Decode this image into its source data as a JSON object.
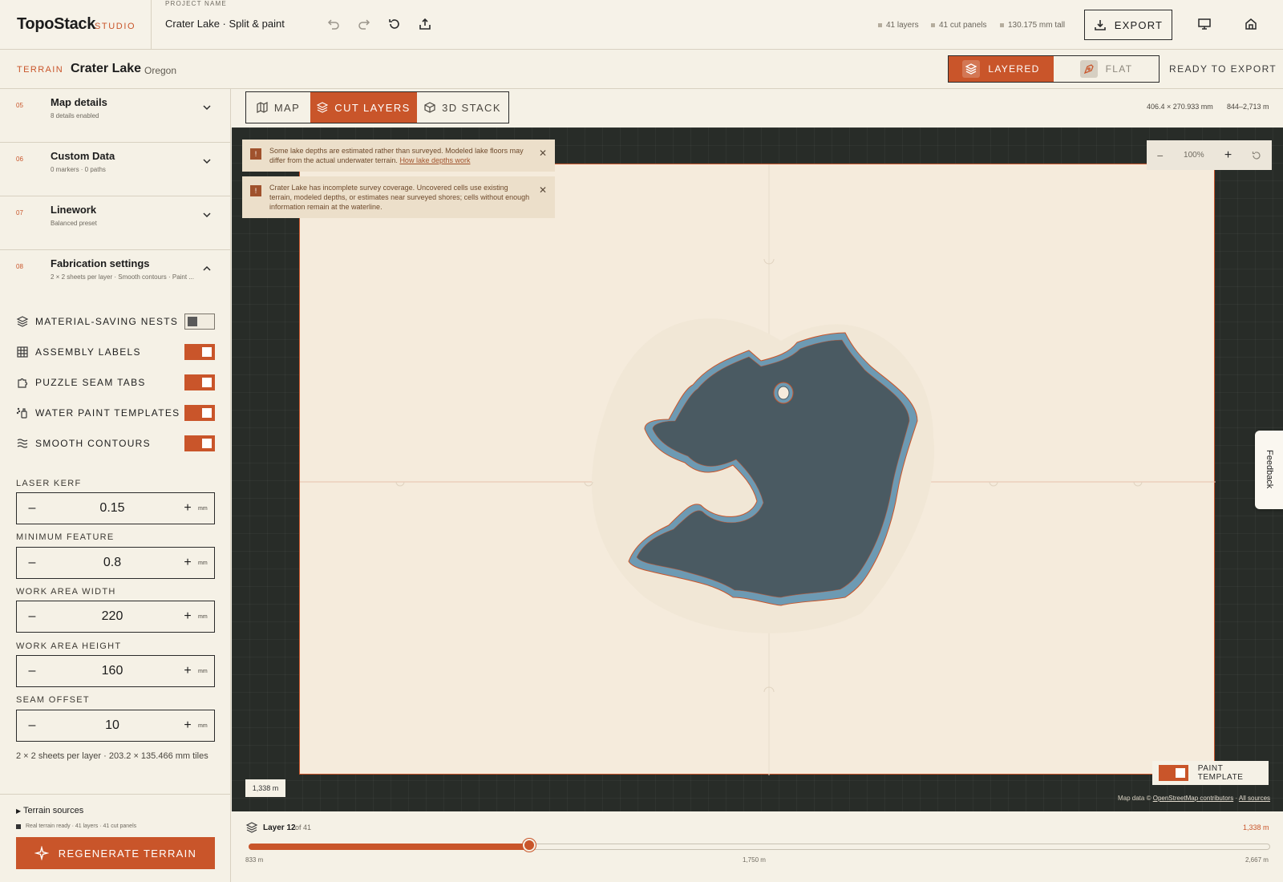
{
  "app": {
    "name": "TopoStack",
    "suffix": "STUDIO"
  },
  "project": {
    "label": "PROJECT NAME",
    "name": "Crater Lake · Split & paint"
  },
  "stats": {
    "layers": "41 layers",
    "panels": "41 cut panels",
    "height": "130.175 mm tall"
  },
  "toolbar": {
    "export_label": "EXPORT"
  },
  "terrain": {
    "tag": "TERRAIN",
    "name": "Crater Lake",
    "region": "Oregon"
  },
  "modes": {
    "layered": "LAYERED",
    "flat": "FLAT",
    "active": "layered"
  },
  "status": {
    "ready": "READY TO EXPORT"
  },
  "sidebar": {
    "sections": [
      {
        "num": "05",
        "title": "Map details",
        "sub": "8 details enabled",
        "expanded": false
      },
      {
        "num": "06",
        "title": "Custom Data",
        "sub": "0 markers · 0 paths",
        "expanded": false
      },
      {
        "num": "07",
        "title": "Linework",
        "sub": "Balanced preset",
        "expanded": false
      },
      {
        "num": "08",
        "title": "Fabrication settings",
        "sub": "2 × 2 sheets per layer · Smooth contours · Paint ...",
        "expanded": true
      }
    ],
    "toggles": [
      {
        "label": "MATERIAL-SAVING NESTS",
        "icon": "layers-icon",
        "on": false
      },
      {
        "label": "ASSEMBLY LABELS",
        "icon": "grid-icon",
        "on": true
      },
      {
        "label": "PUZZLE SEAM TABS",
        "icon": "puzzle-icon",
        "on": true
      },
      {
        "label": "WATER PAINT TEMPLATES",
        "icon": "paint-icon",
        "on": true
      },
      {
        "label": "SMOOTH CONTOURS",
        "icon": "waves-icon",
        "on": true
      }
    ],
    "fields": [
      {
        "label": "LASER KERF",
        "value": "0.15",
        "unit": "mm"
      },
      {
        "label": "MINIMUM FEATURE",
        "value": "0.8",
        "unit": "mm"
      },
      {
        "label": "WORK AREA WIDTH",
        "value": "220",
        "unit": "mm"
      },
      {
        "label": "WORK AREA HEIGHT",
        "value": "160",
        "unit": "mm"
      },
      {
        "label": "SEAM OFFSET",
        "value": "10",
        "unit": "mm"
      }
    ],
    "sheets_info": "2 × 2 sheets per layer · 203.2 × 135.466 mm tiles",
    "sources_label": "Terrain sources",
    "ready_line": "Real terrain ready · 41 layers · 41 cut panels",
    "regen_label": "REGENERATE TERRAIN"
  },
  "view_tabs": [
    {
      "label": "MAP",
      "active": false
    },
    {
      "label": "CUT LAYERS",
      "active": true
    },
    {
      "label": "3D STACK",
      "active": false
    }
  ],
  "viewport": {
    "dims": "406.4 × 270.933 mm",
    "elev_range": "844–2,713 m",
    "zoom": "100%",
    "scale_badge": "1,338 m"
  },
  "alerts": [
    {
      "text": "Some lake depths are estimated rather than surveyed. Modeled lake floors may differ from the actual underwater terrain.",
      "link": "How lake depths work"
    },
    {
      "text": "Crater Lake has incomplete survey coverage. Uncovered cells use existing terrain, modeled depths, or estimates near surveyed shores; cells without enough information remain at the waterline."
    }
  ],
  "paint_template": {
    "label": "PAINT TEMPLATE",
    "on": true
  },
  "attribution": {
    "prefix": "Map data ©",
    "osm": "OpenStreetMap contributors",
    "sep": " · ",
    "all": "All sources"
  },
  "feedback_label": "Feedback",
  "layer": {
    "label": "Layer 12",
    "of": "of 41",
    "elevation": "1,338 m",
    "fraction": 0.275,
    "ticks": [
      "833 m",
      "1,750 m",
      "2,667 m"
    ]
  },
  "colors": {
    "accent": "#c9552a",
    "lake": "#4a5a62",
    "lake_rim": "#6d9ab3"
  }
}
